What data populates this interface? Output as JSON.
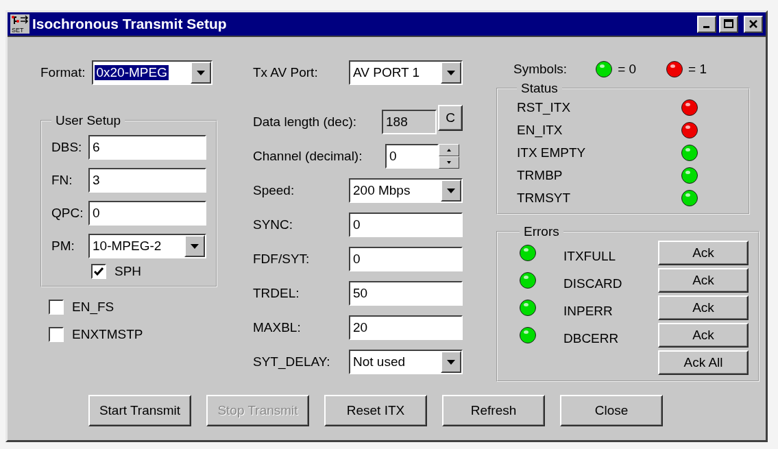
{
  "window": {
    "title": "Isochronous Transmit Setup",
    "icon_text": "SET"
  },
  "format": {
    "label": "Format:",
    "value": "0x20-MPEG",
    "focused": true
  },
  "user_setup": {
    "title": "User Setup",
    "fields": [
      {
        "kind": "text",
        "label": "DBS:",
        "value": "6"
      },
      {
        "kind": "text",
        "label": "FN:",
        "value": "3"
      },
      {
        "kind": "text",
        "label": "QPC:",
        "value": "0"
      },
      {
        "kind": "combo",
        "label": "PM:",
        "value": "10-MPEG-2"
      }
    ],
    "checkbox": {
      "label": "SPH",
      "checked": true
    }
  },
  "options": [
    {
      "label": "EN_FS",
      "checked": false
    },
    {
      "label": "ENXTMSTP",
      "checked": false
    }
  ],
  "settings": [
    {
      "kind": "combo",
      "label": "Tx AV Port:",
      "value": "AV PORT 1"
    },
    {
      "kind": "readonly",
      "label": "Data length (dec):",
      "value": "188",
      "button": "C"
    },
    {
      "kind": "spin",
      "label": "Channel (decimal):",
      "value": "0"
    },
    {
      "kind": "combo",
      "label": "Speed:",
      "value": "200 Mbps"
    },
    {
      "kind": "text",
      "label": "SYNC:",
      "value": "0"
    },
    {
      "kind": "text",
      "label": "FDF/SYT:",
      "value": "0"
    },
    {
      "kind": "text",
      "label": "TRDEL:",
      "value": "50"
    },
    {
      "kind": "text",
      "label": "MAXBL:",
      "value": "20"
    },
    {
      "kind": "combo",
      "label": "SYT_DELAY:",
      "value": "Not used"
    }
  ],
  "symbols": {
    "label": "Symbols:",
    "items": [
      {
        "color": "#00dd00",
        "text": "= 0"
      },
      {
        "color": "#ee0000",
        "text": "= 1"
      }
    ]
  },
  "status": {
    "title": "Status",
    "items": [
      {
        "name": "RST_ITX",
        "color": "#ee0000"
      },
      {
        "name": "EN_ITX",
        "color": "#ee0000"
      },
      {
        "name": "ITX EMPTY",
        "color": "#00dd00"
      },
      {
        "name": "TRMBP",
        "color": "#00dd00"
      },
      {
        "name": "TRMSYT",
        "color": "#00dd00"
      }
    ]
  },
  "errors": {
    "title": "Errors",
    "items": [
      {
        "name": "ITXFULL",
        "color": "#00dd00",
        "button": "Ack"
      },
      {
        "name": "DISCARD",
        "color": "#00dd00",
        "button": "Ack"
      },
      {
        "name": "INPERR",
        "color": "#00dd00",
        "button": "Ack"
      },
      {
        "name": "DBCERR",
        "color": "#00dd00",
        "button": "Ack"
      }
    ],
    "ack_all": "Ack All"
  },
  "buttons": [
    {
      "label": "Start Transmit",
      "disabled": false
    },
    {
      "label": "Stop Transmit",
      "disabled": true
    },
    {
      "label": "Reset ITX",
      "disabled": false
    },
    {
      "label": "Refresh",
      "disabled": false
    },
    {
      "label": "Close",
      "disabled": false
    }
  ]
}
